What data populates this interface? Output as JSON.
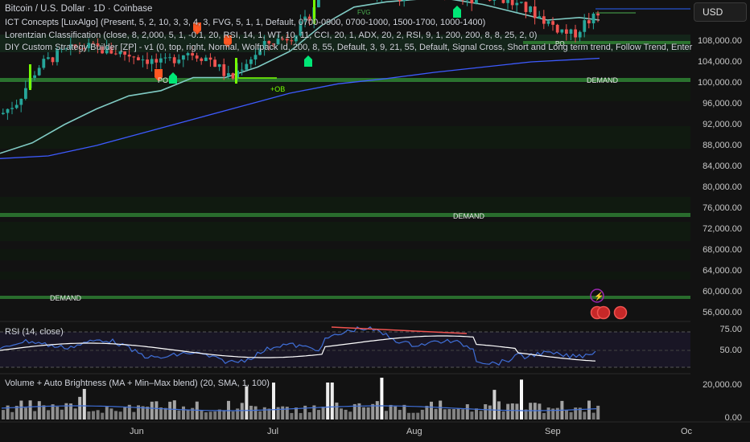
{
  "header": {
    "title": "Bitcoin / U.S. Dollar · 1D · Coinbase",
    "indicators": [
      "ICT Concepts [LuxAlgo] (Present, 5, 2, 10, 3, 3, 4, 3, FVG, 5, 1, 1, Default, 0700-0900, 0700-1000, 1500-1700, 1000-1400)",
      "Lorentzian Classification (close, 8, 2,000, 5, 1, -0.1, 20, RSI, 14, 1, WT, 10, 11, CCI, 20, 1, ADX, 20, 2, RSI, 9, 1, 200, 200, 8, 8, 25, 2, 0)",
      "DIY Custom Strategy Builder [ZP] - v1 (0, top, right, Normal, Wolfpack Id, 200, 8, 55, Default, 3, 9, 21, 55, Default, Signal Cross, Short and Long term trend, Follow Trend, Enter"
    ]
  },
  "currency_button": "USD",
  "price_axis": [
    "108,000.00",
    "104,000.00",
    "100,000.00",
    "96,000.00",
    "92,000.00",
    "88,000.00",
    "84,000.00",
    "80,000.00",
    "76,000.00",
    "72,000.00",
    "68,000.00",
    "64,000.00",
    "60,000.00",
    "56,000.00"
  ],
  "zones": {
    "demand_1": "DEMAND",
    "demand_2": "DEMAND",
    "demand_3": "DEMAND",
    "ob": "+OB",
    "po": "PO",
    "fvg": "FVG",
    "po2": "PO"
  },
  "rsi": {
    "label": "RSI (14, close)",
    "axis": [
      "75.00",
      "50.00"
    ]
  },
  "volume": {
    "label": "Volume + Auto Brightness (MA + Min–Max blend) (20, SMA, 1, 100)",
    "axis": [
      "20,000.00",
      "0.00"
    ]
  },
  "time_axis": [
    "Jun",
    "Jul",
    "Aug",
    "Sep",
    "Oc"
  ],
  "colors": {
    "background": "#121212",
    "bull": "#26a69a",
    "bear": "#ef5350",
    "demand": "#2e7d32",
    "ema_teal": "#80cbc4",
    "sma_blue": "#3d5afe",
    "rsi_line": "#3f6fd8",
    "rsi_ma": "#ffffff",
    "lime": "#76ff03"
  },
  "chart_data": {
    "type": "candlestick",
    "ylim": [
      54000,
      114000
    ],
    "x_ticks": [
      "Jun",
      "Jul",
      "Aug",
      "Sep",
      "Oc"
    ],
    "series": [
      {
        "name": "EMA",
        "points": [
          [
            0,
            86500
          ],
          [
            40,
            88500
          ],
          [
            80,
            92000
          ],
          [
            120,
            95000
          ],
          [
            160,
            97500
          ],
          [
            200,
            98500
          ],
          [
            240,
            101000
          ],
          [
            280,
            101000
          ],
          [
            320,
            103000
          ],
          [
            360,
            106000
          ],
          [
            400,
            111000
          ],
          [
            440,
            114500
          ],
          [
            480,
            115500
          ],
          [
            520,
            116000
          ],
          [
            560,
            116000
          ],
          [
            600,
            115000
          ],
          [
            640,
            113500
          ],
          [
            680,
            112000
          ],
          [
            720,
            112500
          ],
          [
            745,
            112000
          ]
        ]
      },
      {
        "name": "SMA",
        "points": [
          [
            0,
            85500
          ],
          [
            60,
            86000
          ],
          [
            120,
            88000
          ],
          [
            180,
            90500
          ],
          [
            240,
            93000
          ],
          [
            300,
            95500
          ],
          [
            360,
            98000
          ],
          [
            420,
            99800
          ],
          [
            480,
            100800
          ],
          [
            540,
            102000
          ],
          [
            600,
            103000
          ],
          [
            660,
            104000
          ],
          [
            720,
            104500
          ],
          [
            745,
            104700
          ]
        ]
      }
    ]
  }
}
